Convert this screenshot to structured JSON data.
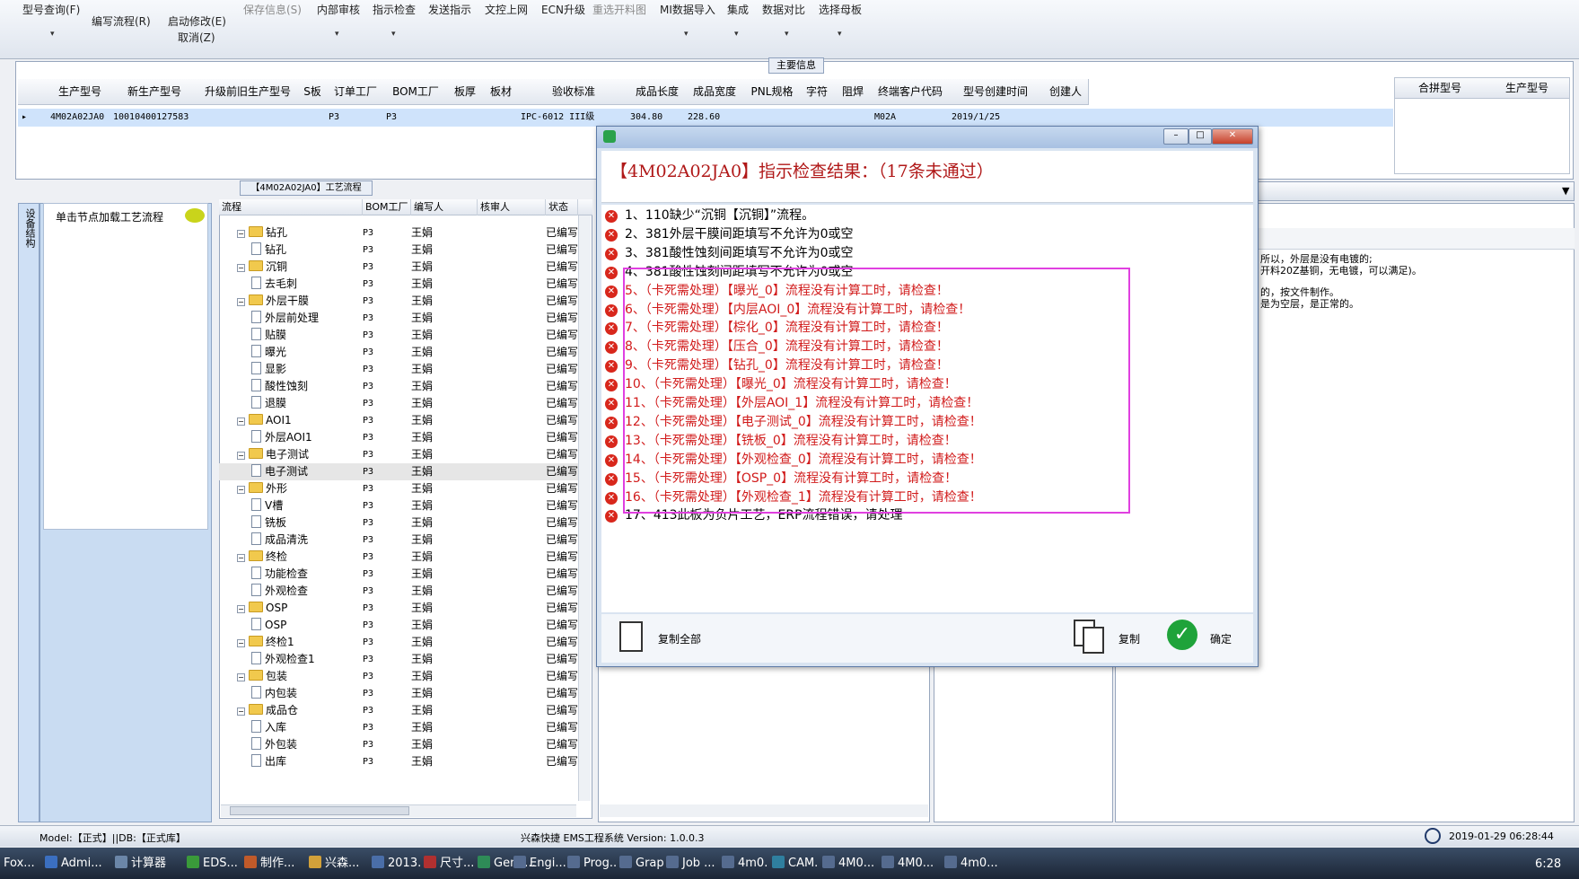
{
  "toolbar": {
    "items": [
      {
        "label": "型号查询(F)"
      },
      {
        "label": "编写流程(R)"
      },
      {
        "label": "启动修改(E)"
      },
      {
        "label": "取消(Z)"
      },
      {
        "label": "保存信息(S)"
      },
      {
        "label": "内部审核"
      },
      {
        "label": "指示检查"
      },
      {
        "label": "发送指示"
      },
      {
        "label": "文控上网"
      },
      {
        "label": "ECN升级"
      },
      {
        "label": "重选开料图"
      },
      {
        "label": "MI数据导入"
      },
      {
        "label": "集成"
      },
      {
        "label": "数据对比"
      },
      {
        "label": "选择母板"
      }
    ]
  },
  "main_info": {
    "tab_label": "主要信息",
    "columns": [
      "生产型号",
      "新生产型号",
      "升级前旧生产型号",
      "S板",
      "订单工厂",
      "BOM工厂",
      "板厚",
      "板材",
      "验收标准",
      "成品长度",
      "成品宽度",
      "PNL规格",
      "字符",
      "阻焊",
      "终端客户代码",
      "型号创建时间",
      "创建人"
    ],
    "row": {
      "prod_no": "4M02A02JA0",
      "new_prod_no": "10010400127583",
      "order_factory": "P3",
      "bom_factory": "P3",
      "standard": "IPC-6012 III级",
      "length": "304.80",
      "width": "228.60",
      "customer": "M02A",
      "created": "2019/1/25"
    },
    "merge_columns": [
      "合拼型号",
      "生产型号"
    ]
  },
  "left_panel": {
    "strip_label": "设备结构",
    "hint": "单击节点加载工艺流程"
  },
  "tree": {
    "tab_label": "【4M02A02JA0】工艺流程",
    "columns": [
      "流程",
      "BOM工厂",
      "编写人",
      "核审人",
      "状态"
    ],
    "rows": [
      {
        "name": "钻孔",
        "bom": "P3",
        "author": "王娟",
        "status": "已编写"
      },
      {
        "name": "钻孔",
        "bom": "P3",
        "author": "王娟",
        "status": "已编写"
      },
      {
        "name": "沉铜",
        "bom": "P3",
        "author": "王娟",
        "status": "已编写"
      },
      {
        "name": "去毛刺",
        "bom": "P3",
        "author": "王娟",
        "status": "已编写"
      },
      {
        "name": "外层干膜",
        "bom": "P3",
        "author": "王娟",
        "status": "已编写"
      },
      {
        "name": "外层前处理",
        "bom": "P3",
        "author": "王娟",
        "status": "已编写"
      },
      {
        "name": "贴膜",
        "bom": "P3",
        "author": "王娟",
        "status": "已编写"
      },
      {
        "name": "曝光",
        "bom": "P3",
        "author": "王娟",
        "status": "已编写"
      },
      {
        "name": "显影",
        "bom": "P3",
        "author": "王娟",
        "status": "已编写"
      },
      {
        "name": "酸性蚀刻",
        "bom": "P3",
        "author": "王娟",
        "status": "已编写"
      },
      {
        "name": "退膜",
        "bom": "P3",
        "author": "王娟",
        "status": "已编写"
      },
      {
        "name": "AOI1",
        "bom": "P3",
        "author": "王娟",
        "status": "已编写"
      },
      {
        "name": "外层AOI1",
        "bom": "P3",
        "author": "王娟",
        "status": "已编写"
      },
      {
        "name": "电子测试",
        "bom": "P3",
        "author": "王娟",
        "status": "已编写"
      },
      {
        "name": "电子测试",
        "bom": "P3",
        "author": "王娟",
        "status": "已编写"
      },
      {
        "name": "外形",
        "bom": "P3",
        "author": "王娟",
        "status": "已编写"
      },
      {
        "name": "V槽",
        "bom": "P3",
        "author": "王娟",
        "status": "已编写"
      },
      {
        "name": "铣板",
        "bom": "P3",
        "author": "王娟",
        "status": "已编写"
      },
      {
        "name": "成品清洗",
        "bom": "P3",
        "author": "王娟",
        "status": "已编写"
      },
      {
        "name": "终检",
        "bom": "P3",
        "author": "王娟",
        "status": "已编写"
      },
      {
        "name": "功能检查",
        "bom": "P3",
        "author": "王娟",
        "status": "已编写"
      },
      {
        "name": "外观检查",
        "bom": "P3",
        "author": "王娟",
        "status": "已编写"
      },
      {
        "name": "OSP",
        "bom": "P3",
        "author": "王娟",
        "status": "已编写"
      },
      {
        "name": "OSP",
        "bom": "P3",
        "author": "王娟",
        "status": "已编写"
      },
      {
        "name": "终检1",
        "bom": "P3",
        "author": "王娟",
        "status": "已编写"
      },
      {
        "name": "外观检查1",
        "bom": "P3",
        "author": "王娟",
        "status": "已编写"
      },
      {
        "name": "包装",
        "bom": "P3",
        "author": "王娟",
        "status": "已编写"
      },
      {
        "name": "内包装",
        "bom": "P3",
        "author": "王娟",
        "status": "已编写"
      },
      {
        "name": "成品仓",
        "bom": "P3",
        "author": "王娟",
        "status": "已编写"
      },
      {
        "name": "入库",
        "bom": "P3",
        "author": "王娟",
        "status": "已编写"
      },
      {
        "name": "外包装",
        "bom": "P3",
        "author": "王娟",
        "status": "已编写"
      },
      {
        "name": "出库",
        "bom": "P3",
        "author": "王娟",
        "status": "已编写"
      }
    ]
  },
  "right_panel": {
    "lines": [
      "所以，外层是没有电镀的;",
      "开料20Z基铜，无电镀，可以满足)。",
      "的，按文件制作。",
      "是为空层，是正常的。"
    ]
  },
  "dialog": {
    "heading": "【4M02A02JA0】指示检查结果：（17条未通过）",
    "messages": [
      {
        "text": "1、110缺少“沉铜【沉铜】”流程。",
        "red": false
      },
      {
        "text": "2、381外层干膜间距填写不允许为0或空",
        "red": false
      },
      {
        "text": "3、381酸性蚀刻间距填写不允许为0或空",
        "red": false
      },
      {
        "text": "4、381酸性蚀刻间距填写不允许为0或空",
        "red": false
      },
      {
        "text": "5、（卡死需处理）【曝光_0】流程没有计算工时，请检查！",
        "red": true
      },
      {
        "text": "6、（卡死需处理）【内层AOI_0】流程没有计算工时，请检查！",
        "red": true
      },
      {
        "text": "7、（卡死需处理）【棕化_0】流程没有计算工时，请检查！",
        "red": true
      },
      {
        "text": "8、（卡死需处理）【压合_0】流程没有计算工时，请检查！",
        "red": true
      },
      {
        "text": "9、（卡死需处理）【钻孔_0】流程没有计算工时，请检查！",
        "red": true
      },
      {
        "text": "10、（卡死需处理）【曝光_0】流程没有计算工时，请检查！",
        "red": true
      },
      {
        "text": "11、（卡死需处理）【外层AOI_1】流程没有计算工时，请检查！",
        "red": true
      },
      {
        "text": "12、（卡死需处理）【电子测试_0】流程没有计算工时，请检查！",
        "red": true
      },
      {
        "text": "13、（卡死需处理）【铣板_0】流程没有计算工时，请检查！",
        "red": true
      },
      {
        "text": "14、（卡死需处理）【外观检查_0】流程没有计算工时，请检查！",
        "red": true
      },
      {
        "text": "15、（卡死需处理）【OSP_0】流程没有计算工时，请检查！",
        "red": true
      },
      {
        "text": "16、（卡死需处理）【外观检查_1】流程没有计算工时，请检查！",
        "red": true
      },
      {
        "text": "17、413此板为负片工艺，ERP流程错误，请处理",
        "red": false
      }
    ],
    "copy_all_label": "复制全部",
    "copy_label": "复制",
    "ok_label": "确定",
    "colors": {
      "error_text": "#d11b1b",
      "highlight": "#e040e0"
    }
  },
  "status_bar": {
    "left": "Model:【正式】||DB:【正式库】",
    "center": "兴森快捷 EMS工程系统 Version: 1.0.0.3",
    "datetime": "2019-01-29 06:28:44"
  },
  "taskbar": {
    "items": [
      "Fox...",
      "Admi...",
      "计算器",
      "EDS...",
      "制作...",
      "兴森...",
      "2013...",
      "尺寸...",
      "Gene...",
      "Engi...",
      "Prog...",
      "Grap...",
      "Job ...",
      "4m0...",
      "CAM...",
      "4M0...",
      "4M0...",
      "4m0..."
    ],
    "clock": "6:28"
  }
}
